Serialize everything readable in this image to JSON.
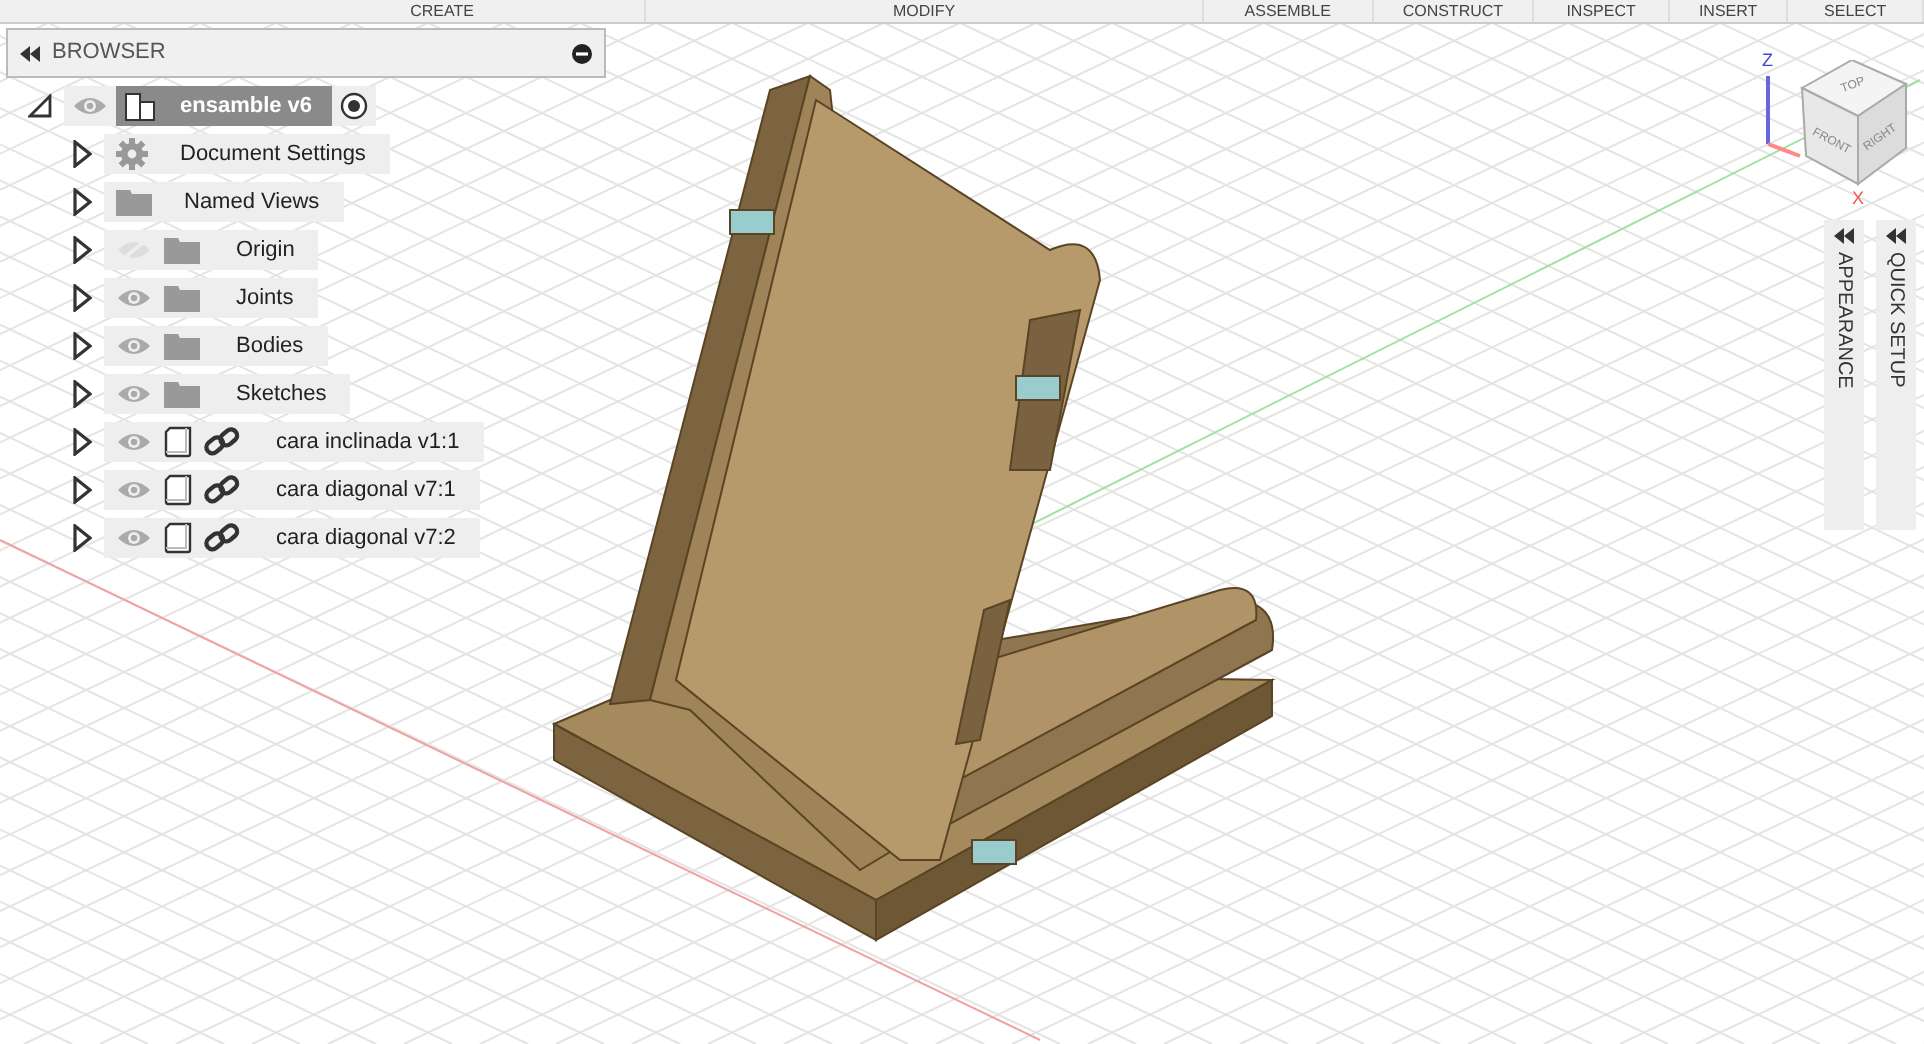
{
  "toolbar": [
    {
      "label": "CREATE"
    },
    {
      "label": "MODIFY"
    },
    {
      "label": "ASSEMBLE"
    },
    {
      "label": "CONSTRUCT"
    },
    {
      "label": "INSPECT"
    },
    {
      "label": "INSERT"
    },
    {
      "label": "SELECT"
    }
  ],
  "browser": {
    "title": "BROWSER",
    "root": {
      "label": "ensamble v6",
      "expanded": true,
      "visible": true,
      "children": [
        {
          "label": "Document Settings",
          "kind": "settings",
          "expanded": false
        },
        {
          "label": "Named Views",
          "kind": "folder",
          "expanded": false
        },
        {
          "label": "Origin",
          "kind": "folder",
          "expanded": false,
          "visible": false
        },
        {
          "label": "Joints",
          "kind": "folder",
          "expanded": false,
          "visible": true
        },
        {
          "label": "Bodies",
          "kind": "folder",
          "expanded": false,
          "visible": true
        },
        {
          "label": "Sketches",
          "kind": "folder",
          "expanded": false,
          "visible": true
        },
        {
          "label": "cara inclinada v1:1",
          "kind": "component",
          "expanded": false,
          "visible": true
        },
        {
          "label": "cara diagonal v7:1",
          "kind": "component",
          "expanded": false,
          "visible": true
        },
        {
          "label": "cara diagonal v7:2",
          "kind": "component",
          "expanded": false,
          "visible": true
        }
      ]
    }
  },
  "viewcube": {
    "faces": [
      "TOP",
      "FRONT",
      "RIGHT"
    ],
    "axes": [
      "Z",
      "X"
    ]
  },
  "side_panels": [
    {
      "label": "APPEARANCE"
    },
    {
      "label": "QUICK SETUP"
    }
  ]
}
